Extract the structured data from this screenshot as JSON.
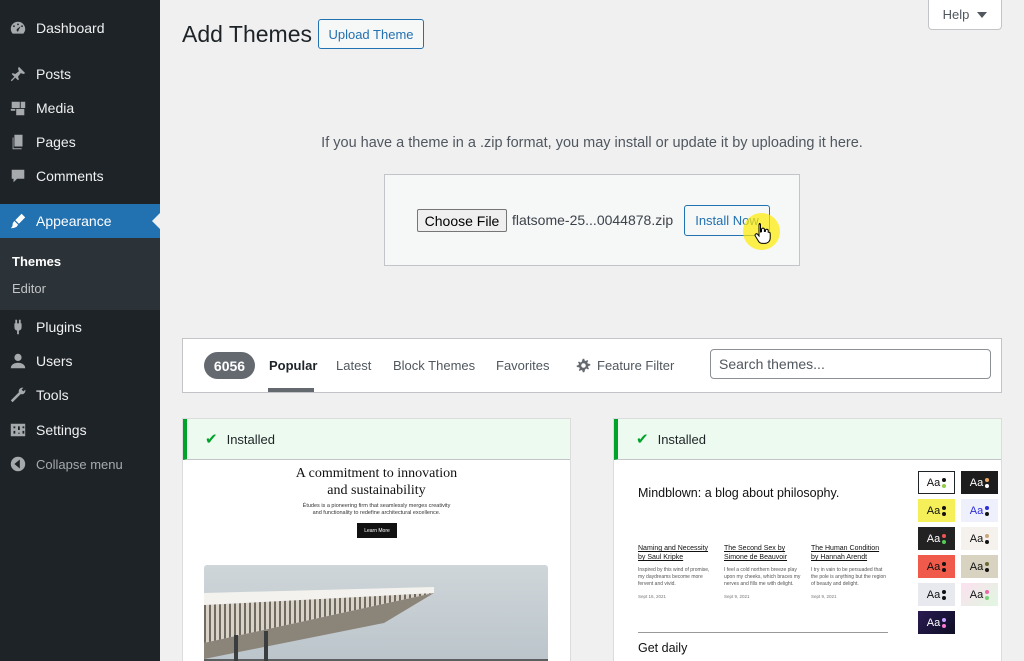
{
  "sidebar": {
    "items": [
      {
        "label": "Dashboard",
        "icon": "dashboard-icon"
      },
      {
        "label": "Posts",
        "icon": "pin-icon"
      },
      {
        "label": "Media",
        "icon": "media-icon"
      },
      {
        "label": "Pages",
        "icon": "pages-icon"
      },
      {
        "label": "Comments",
        "icon": "comment-icon"
      },
      {
        "label": "Appearance",
        "icon": "brush-icon"
      },
      {
        "label": "Plugins",
        "icon": "plug-icon"
      },
      {
        "label": "Users",
        "icon": "user-icon"
      },
      {
        "label": "Tools",
        "icon": "wrench-icon"
      },
      {
        "label": "Settings",
        "icon": "settings-icon"
      }
    ],
    "submenu": [
      {
        "label": "Themes"
      },
      {
        "label": "Editor"
      }
    ],
    "collapse_label": "Collapse menu"
  },
  "header": {
    "title": "Add Themes",
    "upload_button": "Upload Theme",
    "help_label": "Help"
  },
  "upload": {
    "description": "If you have a theme in a .zip format, you may install or update it by uploading it here.",
    "choose_file_label": "Choose File",
    "file_name": "flatsome-25...0044878.zip",
    "install_button": "Install Now"
  },
  "filter": {
    "count": "6056",
    "tabs": [
      "Popular",
      "Latest",
      "Block Themes",
      "Favorites"
    ],
    "feature_filter": "Feature Filter",
    "search_placeholder": "Search themes..."
  },
  "themes": [
    {
      "status": "Installed",
      "preview": {
        "heading_line1": "A commitment to innovation",
        "heading_line2": "and sustainability",
        "text_line1": "Études is a pioneering firm that seamlessly merges creativity",
        "text_line2": "and functionality to redefine architectural excellence.",
        "button": "Learn More"
      }
    },
    {
      "status": "Installed",
      "preview": {
        "title": "Mindblown: a blog about philosophy.",
        "posts": [
          {
            "title_line1": "Naming and Necessity",
            "title_line2": "by Saul Kripke",
            "text_line1": "Inspired by this wind of promise,",
            "text_line2": "my daydreams become more",
            "text_line3": "fervent and vivid.",
            "date": "Sept 16, 2021"
          },
          {
            "title_line1": "The Second Sex by",
            "title_line2": "Simone de Beauvoir",
            "text_line1": "I feel a cold northern breeze play",
            "text_line2": "upon my cheeks, which braces my",
            "text_line3": "nerves and fills me with delight.",
            "date": "Sept 9, 2021"
          },
          {
            "title_line1": "The Human Condition",
            "title_line2": "by Hannah Arendt",
            "text_line1": "I try in vain to be persuaded that",
            "text_line2": "the pole is anything but the region",
            "text_line3": "of beauty and delight.",
            "date": "Sept 9, 2021"
          }
        ],
        "footer_title": "Get daily",
        "swatch_label": "Aa"
      }
    }
  ],
  "colors": {
    "sidebar_bg": "#1d2327",
    "accent": "#2271b1",
    "installed_green": "#00a32a"
  }
}
